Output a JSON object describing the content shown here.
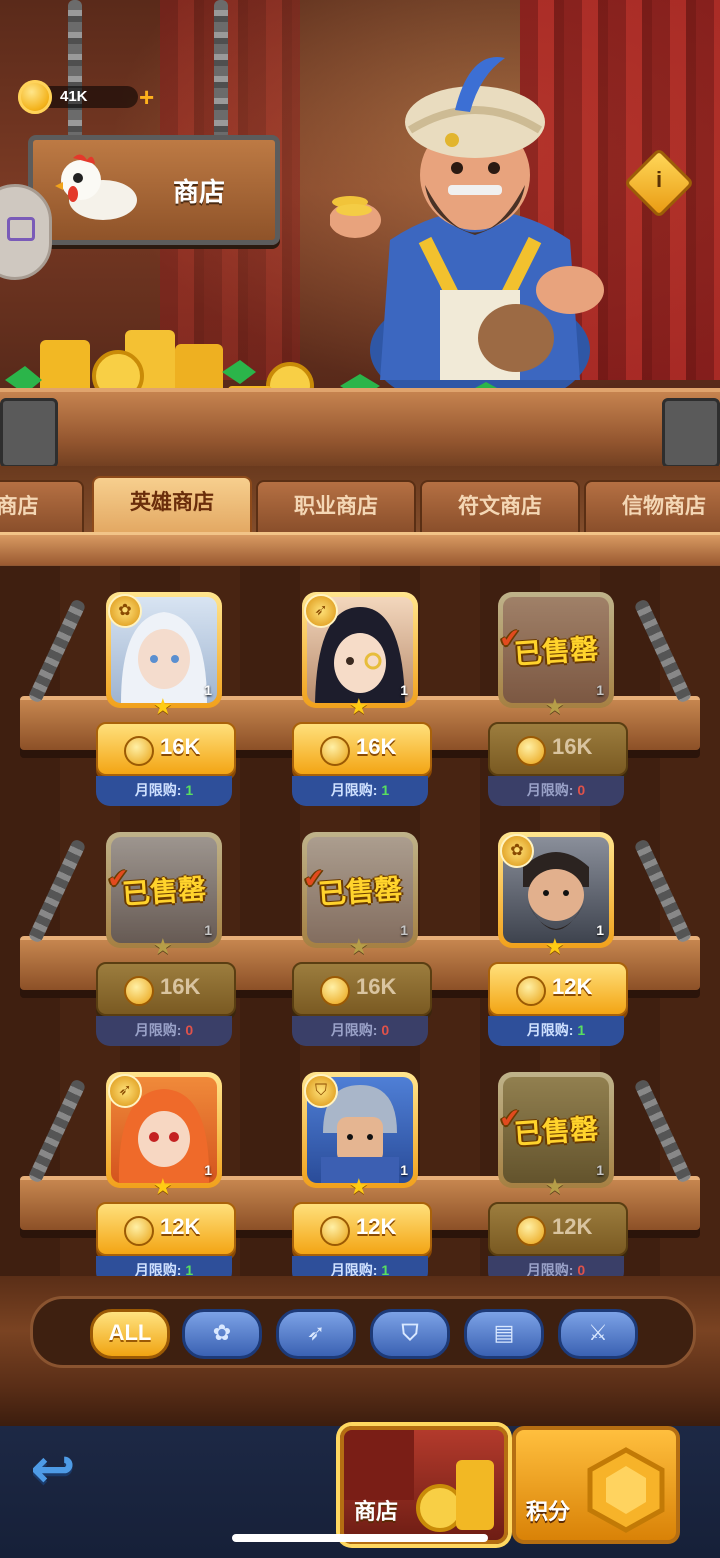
{
  "header": {
    "currency_value": "41K",
    "plus": "+",
    "shop_title": "商店",
    "info_symbol": "i"
  },
  "tabs": [
    "限商店",
    "英雄商店",
    "职业商店",
    "符文商店",
    "信物商店"
  ],
  "active_tab": 1,
  "items": [
    {
      "price": "16K",
      "limit_label": "月限购:",
      "limit_count": "1",
      "sold": false,
      "count": "1",
      "sold_label": ""
    },
    {
      "price": "16K",
      "limit_label": "月限购:",
      "limit_count": "1",
      "sold": false,
      "count": "1",
      "sold_label": ""
    },
    {
      "price": "16K",
      "limit_label": "月限购:",
      "limit_count": "0",
      "sold": true,
      "count": "1",
      "sold_label": "已售罄"
    },
    {
      "price": "16K",
      "limit_label": "月限购:",
      "limit_count": "0",
      "sold": true,
      "count": "1",
      "sold_label": "已售罄"
    },
    {
      "price": "16K",
      "limit_label": "月限购:",
      "limit_count": "0",
      "sold": true,
      "count": "1",
      "sold_label": "已售罄"
    },
    {
      "price": "12K",
      "limit_label": "月限购:",
      "limit_count": "1",
      "sold": false,
      "count": "1",
      "sold_label": ""
    },
    {
      "price": "12K",
      "limit_label": "月限购:",
      "limit_count": "1",
      "sold": false,
      "count": "1",
      "sold_label": ""
    },
    {
      "price": "12K",
      "limit_label": "月限购:",
      "limit_count": "1",
      "sold": false,
      "count": "1",
      "sold_label": ""
    },
    {
      "price": "12K",
      "limit_label": "月限购:",
      "limit_count": "0",
      "sold": true,
      "count": "1",
      "sold_label": "已售罄"
    }
  ],
  "filters": [
    {
      "label": "ALL",
      "icon": "all"
    },
    {
      "label": "",
      "icon": "mage-rose-icon"
    },
    {
      "label": "",
      "icon": "archer-bow-icon"
    },
    {
      "label": "",
      "icon": "tank-shield-icon"
    },
    {
      "label": "",
      "icon": "support-book-icon"
    },
    {
      "label": "",
      "icon": "warrior-sword-icon"
    }
  ],
  "bottom_nav": {
    "shop_label": "商店",
    "points_label": "积分"
  },
  "colors": {
    "gold": "#f3a514",
    "sold": "#7a5a22",
    "limit_blue": "#2e4f9a",
    "limit_ok": "#59e05f",
    "limit_zero": "#e0524a"
  }
}
